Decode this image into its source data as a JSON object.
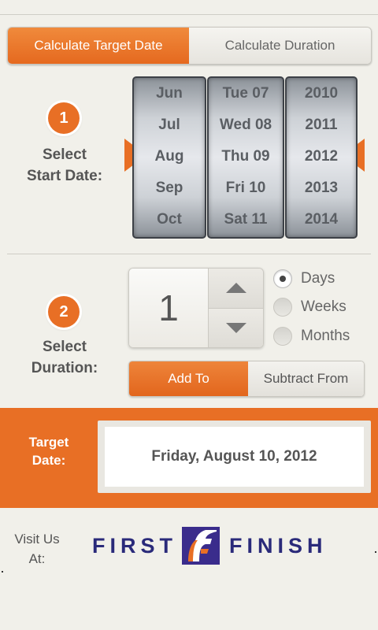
{
  "tabs": {
    "target_label": "Calculate Target Date",
    "duration_label": "Calculate Duration"
  },
  "step1": {
    "number": "1",
    "label_line1": "Select",
    "label_line2": "Start Date:"
  },
  "picker": {
    "months": [
      "Jun",
      "Jul",
      "Aug",
      "Sep",
      "Oct"
    ],
    "days": [
      "Tue 07",
      "Wed 08",
      "Thu 09",
      "Fri 10",
      "Sat 11"
    ],
    "years": [
      "2010",
      "2011",
      "2012",
      "2013",
      "2014"
    ],
    "selected_month": "Aug",
    "selected_day": "Thu 09",
    "selected_year": "2012"
  },
  "step2": {
    "number": "2",
    "label_line1": "Select",
    "label_line2": "Duration:"
  },
  "stepper": {
    "value": "1"
  },
  "units": {
    "options": [
      "Days",
      "Weeks",
      "Months"
    ],
    "selected": "Days"
  },
  "operation": {
    "add_label": "Add To",
    "subtract_label": "Subtract From"
  },
  "result": {
    "label_line1": "Target",
    "label_line2": "Date:",
    "value": "Friday, August 10, 2012"
  },
  "footer": {
    "visit_line1": "Visit Us",
    "visit_line2": "At:",
    "logo_left": "FIRST",
    "logo_right": "FINISH"
  },
  "colors": {
    "accent": "#e86f25",
    "background": "#f1f0ea",
    "logo": "#3a2c8c"
  }
}
